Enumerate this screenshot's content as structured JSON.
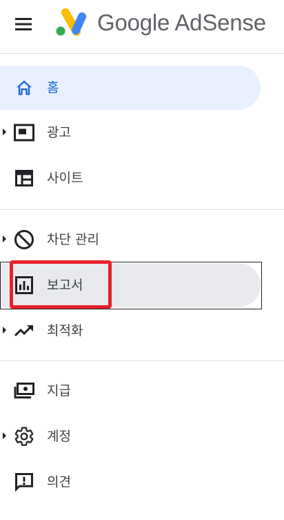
{
  "header": {
    "brand": "Google AdSense",
    "menu_icon": "hamburger-menu-icon",
    "logo_icon": "adsense-logo-icon"
  },
  "colors": {
    "active_bg": "#e8f0fe",
    "active_text": "#1967d2",
    "hover_bg": "#e8eaed",
    "divider": "#dadce0",
    "highlight": "#e8202a",
    "logo_yellow": "#fbbc04",
    "logo_blue": "#4285f4",
    "logo_green": "#34a853"
  },
  "nav": {
    "items": [
      {
        "label": "홈",
        "icon": "home-icon",
        "expandable": false,
        "state": "active"
      },
      {
        "label": "광고",
        "icon": "ads-icon",
        "expandable": true,
        "state": "normal"
      },
      {
        "label": "사이트",
        "icon": "sites-icon",
        "expandable": false,
        "state": "normal"
      },
      {
        "label": "차단 관리",
        "icon": "block-icon",
        "expandable": true,
        "state": "normal"
      },
      {
        "label": "보고서",
        "icon": "bar-chart-icon",
        "expandable": false,
        "state": "hovered"
      },
      {
        "label": "최적화",
        "icon": "trending-up-icon",
        "expandable": true,
        "state": "normal"
      },
      {
        "label": "지급",
        "icon": "payments-icon",
        "expandable": false,
        "state": "normal"
      },
      {
        "label": "계정",
        "icon": "gear-icon",
        "expandable": true,
        "state": "normal"
      },
      {
        "label": "의견",
        "icon": "feedback-icon",
        "expandable": false,
        "state": "normal"
      }
    ]
  }
}
